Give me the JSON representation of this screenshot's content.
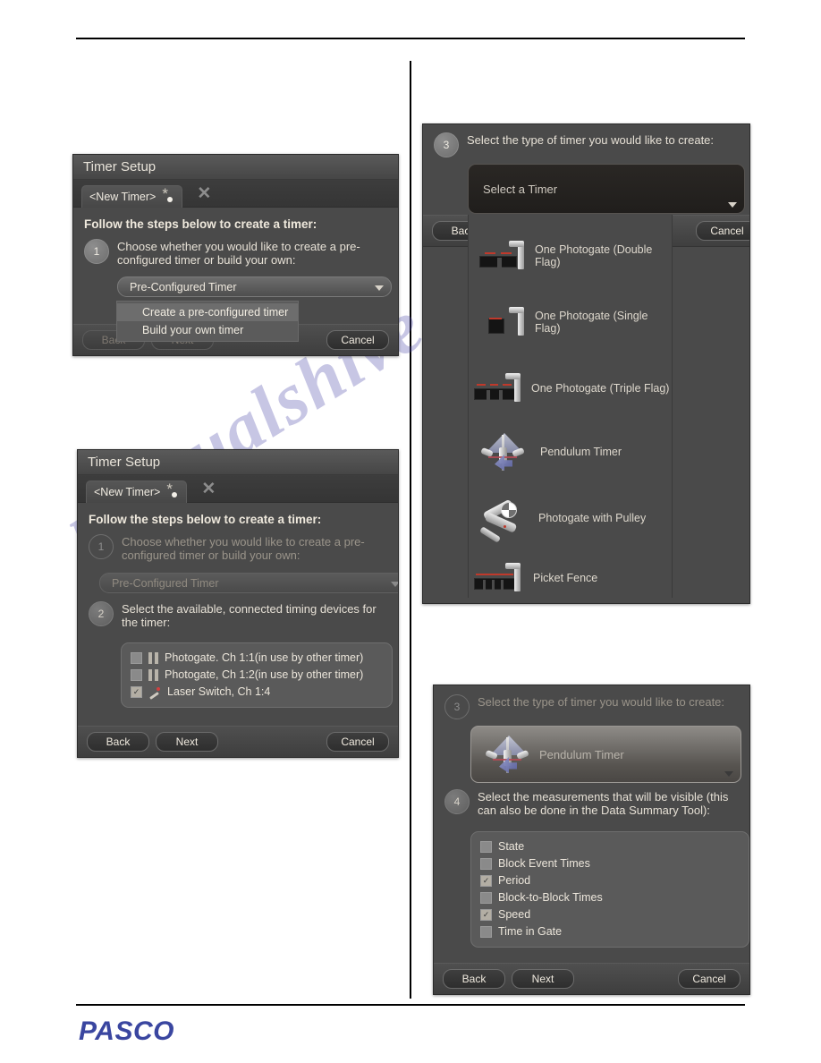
{
  "page": {
    "brand": "PASCO"
  },
  "dialog1": {
    "title": "Timer Setup",
    "tab_label": "<New Timer>",
    "lead": "Follow the steps below to create a timer:",
    "step1": {
      "number": "1",
      "text": "Choose whether you would like to create a pre-configured timer or build your own:",
      "combo_value": "Pre-Configured Timer",
      "options": [
        "Create a pre-configured timer",
        "Build your own timer"
      ]
    },
    "buttons": {
      "back": "Back",
      "next": "Next",
      "cancel": "Cancel"
    }
  },
  "dialog2": {
    "title": "Timer Setup",
    "tab_label": "<New Timer>",
    "lead": "Follow the steps below to create a timer:",
    "step1": {
      "number": "1",
      "text": "Choose whether you would like to create a pre-configured timer or build your own:",
      "combo_value": "Pre-Configured Timer"
    },
    "step2": {
      "number": "2",
      "text": "Select the available, connected timing devices for the timer:",
      "devices": [
        {
          "label": "Photogate. Ch 1:1(in use by other timer)",
          "checked": false,
          "icon": "photogate-icon"
        },
        {
          "label": "Photogate, Ch 1:2(in use by other timer)",
          "checked": false,
          "icon": "photogate-icon"
        },
        {
          "label": "Laser Switch, Ch 1:4",
          "checked": true,
          "icon": "laser-switch-icon"
        }
      ]
    },
    "buttons": {
      "back": "Back",
      "next": "Next",
      "cancel": "Cancel"
    }
  },
  "dialog3": {
    "step3": {
      "number": "3",
      "text": "Select the type of timer you would like to create:",
      "combo_value": "Select a Timer",
      "options": [
        {
          "label": "One Photogate (Double Flag)",
          "icon": "photogate-double-flag-icon"
        },
        {
          "label": "One Photogate (Single Flag)",
          "icon": "photogate-single-flag-icon"
        },
        {
          "label": "One Photogate (Triple Flag)",
          "icon": "photogate-triple-flag-icon"
        },
        {
          "label": "Pendulum Timer",
          "icon": "pendulum-timer-icon"
        },
        {
          "label": "Photogate with Pulley",
          "icon": "photogate-pulley-icon"
        },
        {
          "label": "Picket Fence",
          "icon": "picket-fence-icon"
        }
      ]
    },
    "buttons": {
      "back": "Back",
      "cancel": "Cancel"
    }
  },
  "dialog4": {
    "step3": {
      "number": "3",
      "text": "Select the type of timer you would like to create:",
      "combo_value": "Pendulum Timer"
    },
    "step4": {
      "number": "4",
      "text": "Select the measurements that will be visible (this can also be done in the Data Summary Tool):",
      "measurements": [
        {
          "label": "State",
          "checked": false
        },
        {
          "label": "Block Event Times",
          "checked": false
        },
        {
          "label": "Period",
          "checked": true
        },
        {
          "label": "Block-to-Block Times",
          "checked": false
        },
        {
          "label": "Speed",
          "checked": true
        },
        {
          "label": "Time in Gate",
          "checked": false
        }
      ]
    },
    "buttons": {
      "back": "Back",
      "next": "Next",
      "cancel": "Cancel"
    }
  },
  "watermark": {
    "text": "manualshive.com"
  }
}
